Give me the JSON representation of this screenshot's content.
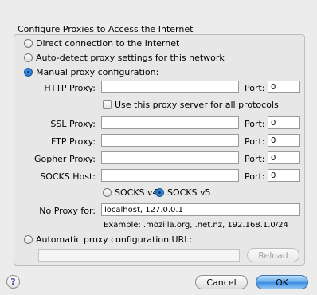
{
  "group_title": "Configure Proxies to Access the Internet",
  "options": {
    "direct": "Direct connection to the Internet",
    "auto_detect": "Auto-detect proxy settings for this network",
    "manual": "Manual proxy configuration:",
    "auto_url": "Automatic proxy configuration URL:"
  },
  "selected_option": "manual",
  "http": {
    "label": "HTTP Proxy:",
    "value": "",
    "port_label": "Port:",
    "port": "0"
  },
  "share_all": {
    "label": "Use this proxy server for all protocols",
    "checked": false
  },
  "ssl": {
    "label": "SSL Proxy:",
    "value": "",
    "port_label": "Port:",
    "port": "0"
  },
  "ftp": {
    "label": "FTP Proxy:",
    "value": "",
    "port_label": "Port:",
    "port": "0"
  },
  "gopher": {
    "label": "Gopher Proxy:",
    "value": "",
    "port_label": "Port:",
    "port": "0"
  },
  "socks": {
    "label": "SOCKS Host:",
    "value": "",
    "port_label": "Port:",
    "port": "0"
  },
  "socks_version": {
    "v4": "SOCKS v4",
    "v5": "SOCKS v5",
    "selected": "v5"
  },
  "no_proxy": {
    "label": "No Proxy for:",
    "value": "localhost, 127.0.0.1",
    "example": "Example: .mozilla.org, .net.nz, 192.168.1.0/24"
  },
  "auto_url_value": "",
  "buttons": {
    "reload": "Reload",
    "cancel": "Cancel",
    "ok": "OK",
    "help": "?"
  }
}
